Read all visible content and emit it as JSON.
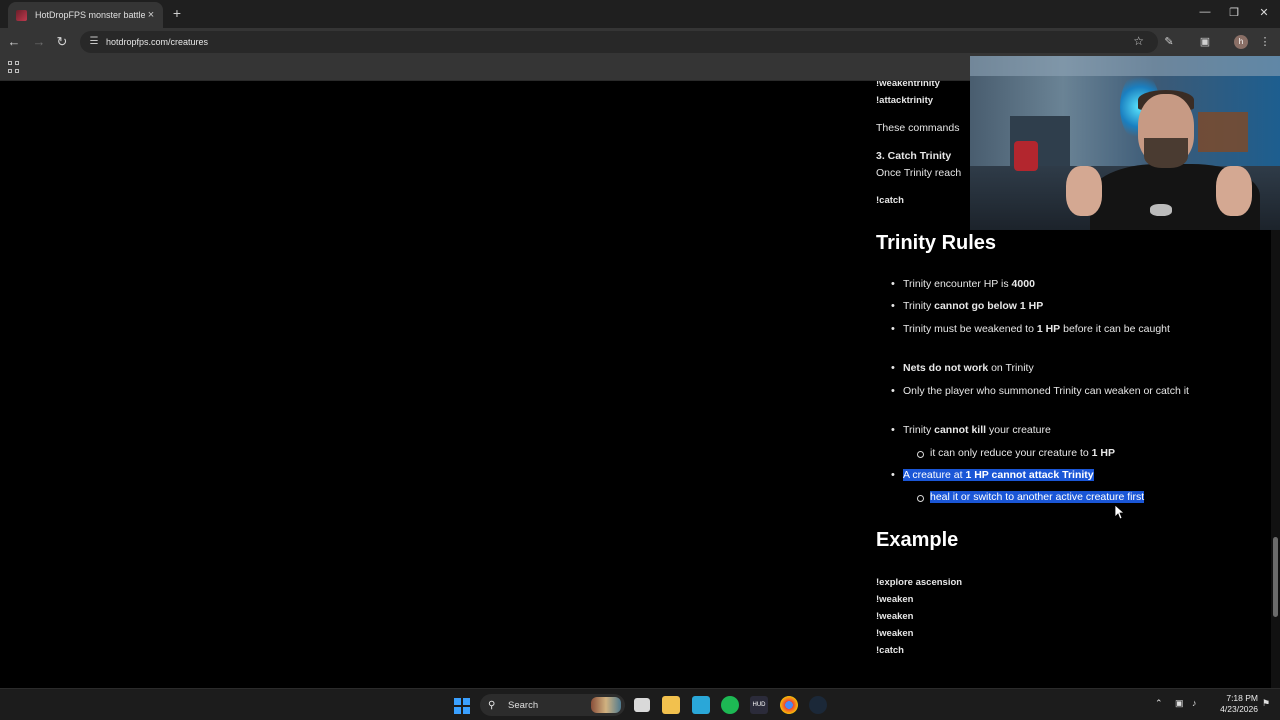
{
  "browser": {
    "tab_title": "HotDropFPS monster battle sty",
    "tab_close": "×",
    "new_tab": "+",
    "url": "hotdropfps.com/creatures",
    "profile_initial": "h"
  },
  "page": {
    "commands_top": [
      "!weakentrinity",
      "!attacktrinity"
    ],
    "commands_note": "These commands",
    "step3_title": "3. Catch Trinity",
    "step3_text": "Once Trinity reach",
    "catch_cmd": "!catch",
    "rules_heading": "Trinity Rules",
    "rules": {
      "r1_a": "Trinity encounter HP is ",
      "r1_b": "4000",
      "r2_a": "Trinity ",
      "r2_b": "cannot go below 1 HP",
      "r3_a": "Trinity must be weakened to ",
      "r3_b": "1 HP",
      "r3_c": " before it can be caught",
      "r4_a": "Nets do not work",
      "r4_b": " on Trinity",
      "r5": "Only the player who summoned Trinity can weaken or catch it",
      "r6_a": "Trinity ",
      "r6_b": "cannot kill",
      "r6_c": " your creature",
      "r6_sub_a": "it can only reduce your creature to ",
      "r6_sub_b": "1 HP",
      "r7_a": "A creature at ",
      "r7_b": "1 HP cannot attack Trinity",
      "r7_sub": "heal it or switch to another active creature first"
    },
    "example_heading": "Example",
    "example_cmds": [
      "!explore ascension",
      "!weaken",
      "!weaken",
      "!weaken",
      "!catch"
    ]
  },
  "taskbar": {
    "search_label": "Search",
    "time": "7:18 PM",
    "date": "4/23/2026"
  },
  "colors": {
    "selection": "#1a56d6",
    "page_bg": "#000000",
    "chrome_bg": "#353535"
  }
}
